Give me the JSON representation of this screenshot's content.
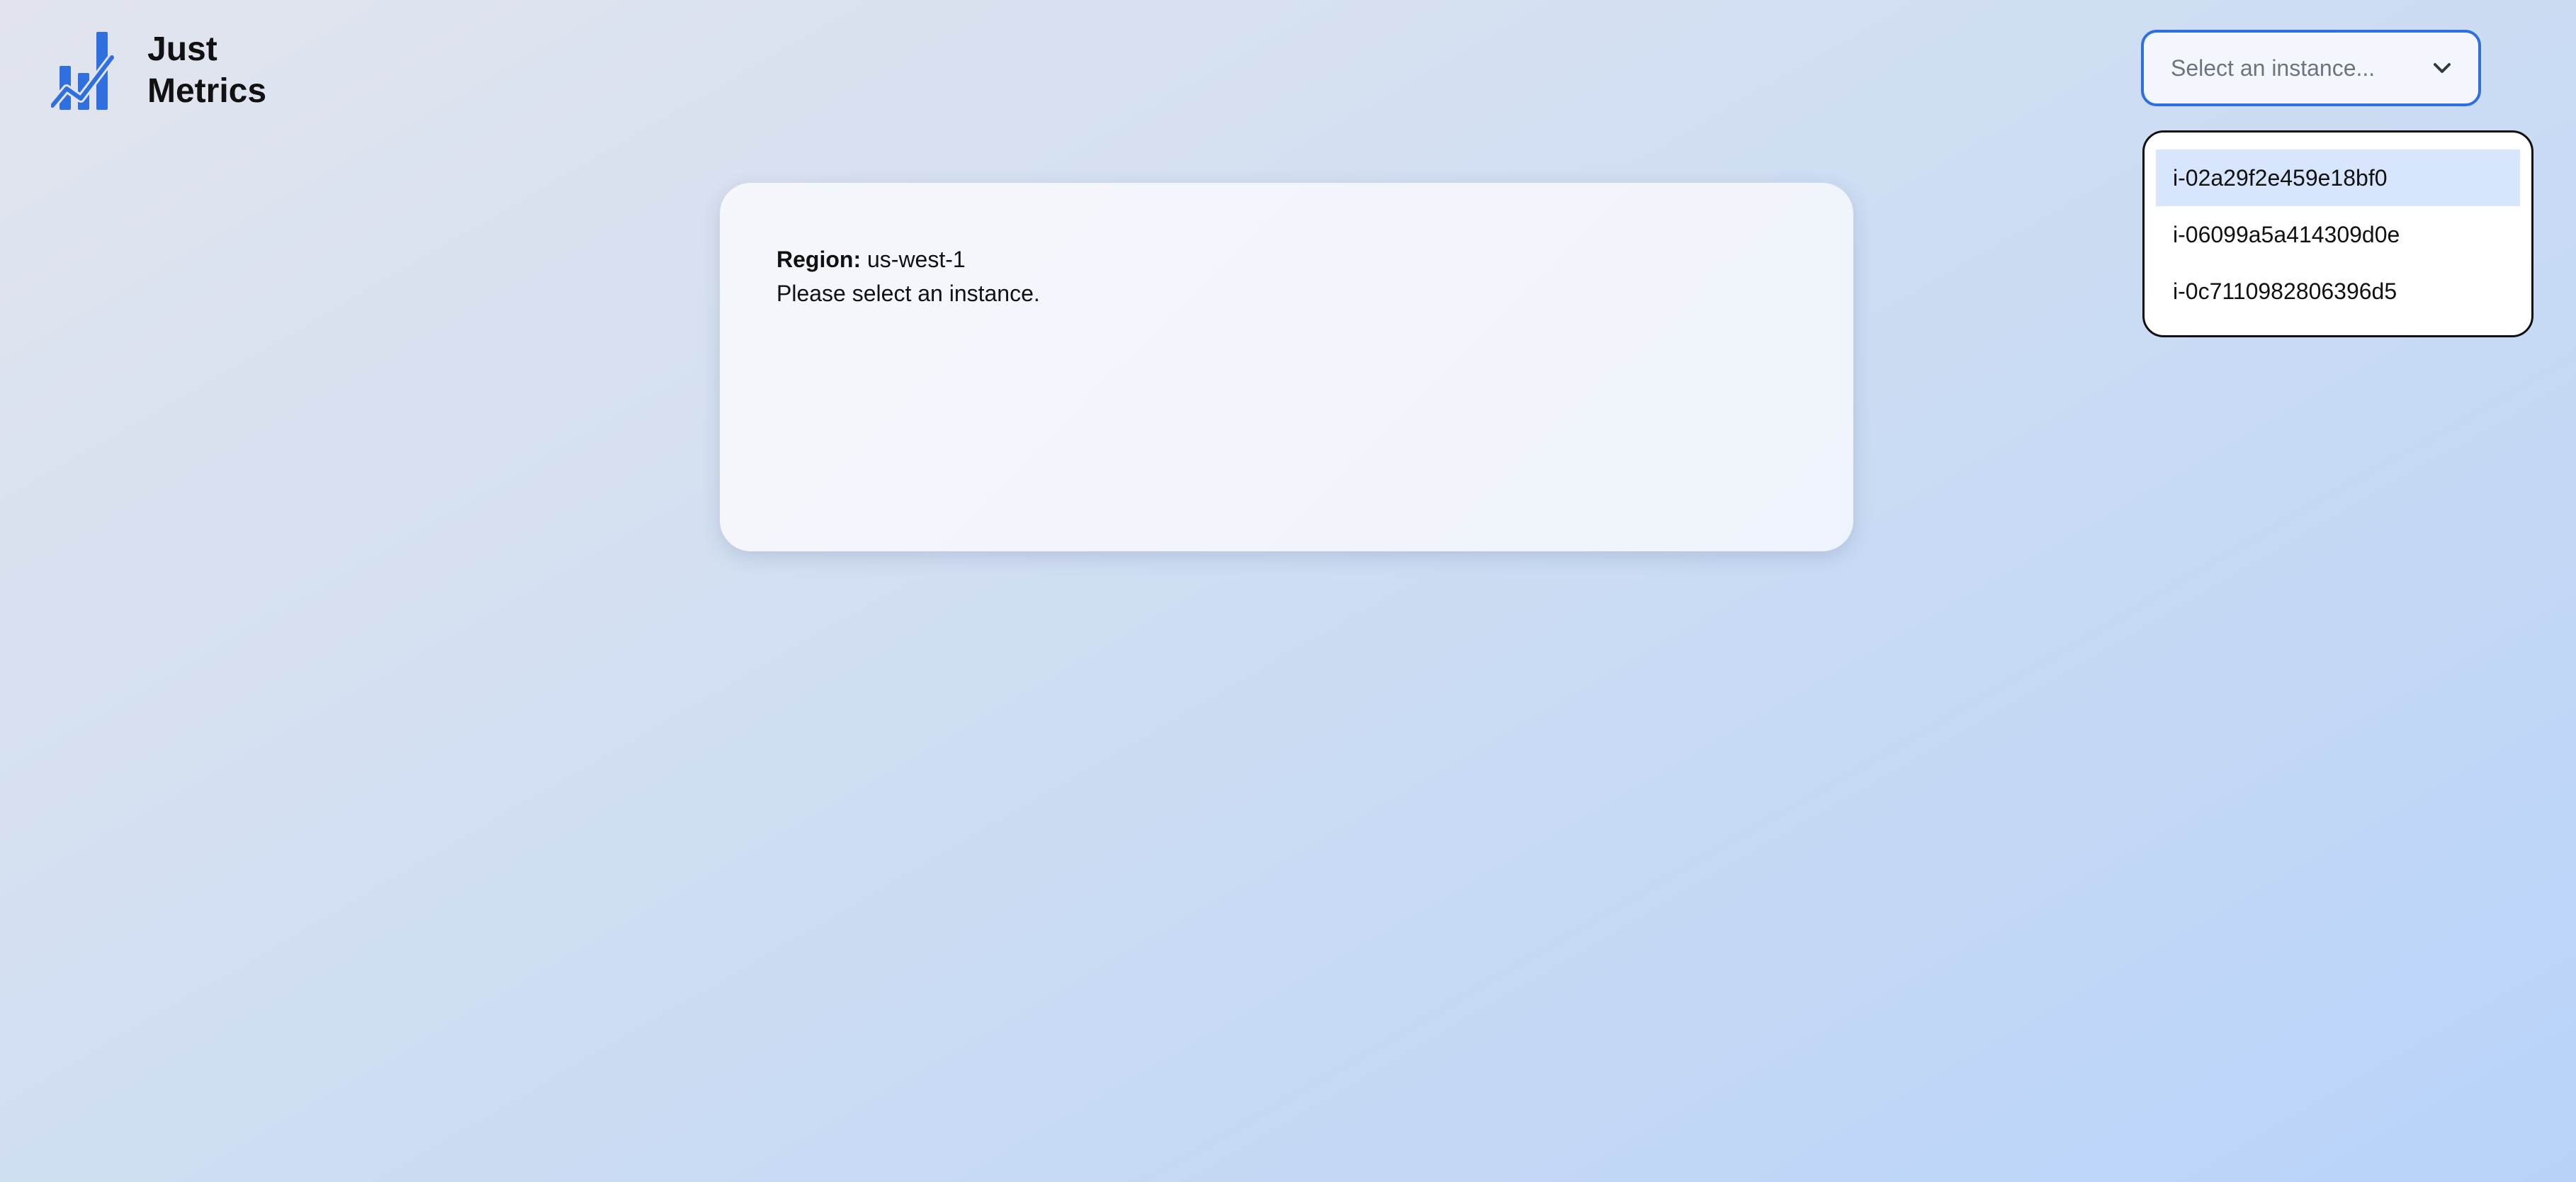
{
  "brand": {
    "name_line1": "Just",
    "name_line2": "Metrics",
    "icon": "bar-chart-trend-icon",
    "color": "#2f6fe0"
  },
  "instance_select": {
    "placeholder": "Select an instance...",
    "icon": "chevron-down-icon",
    "border_color": "#2f6fe0",
    "options": [
      {
        "label": "i-02a29f2e459e18bf0"
      },
      {
        "label": "i-06099a5a414309d0e"
      },
      {
        "label": "i-0c7110982806396d5"
      }
    ],
    "highlighted_option": "i-02a29f2e459e18bf0",
    "highlight_color": "#d7e6fc"
  },
  "info_card": {
    "region_label": "Region:",
    "region_value": "us-west-1",
    "message": "Please select an instance."
  }
}
